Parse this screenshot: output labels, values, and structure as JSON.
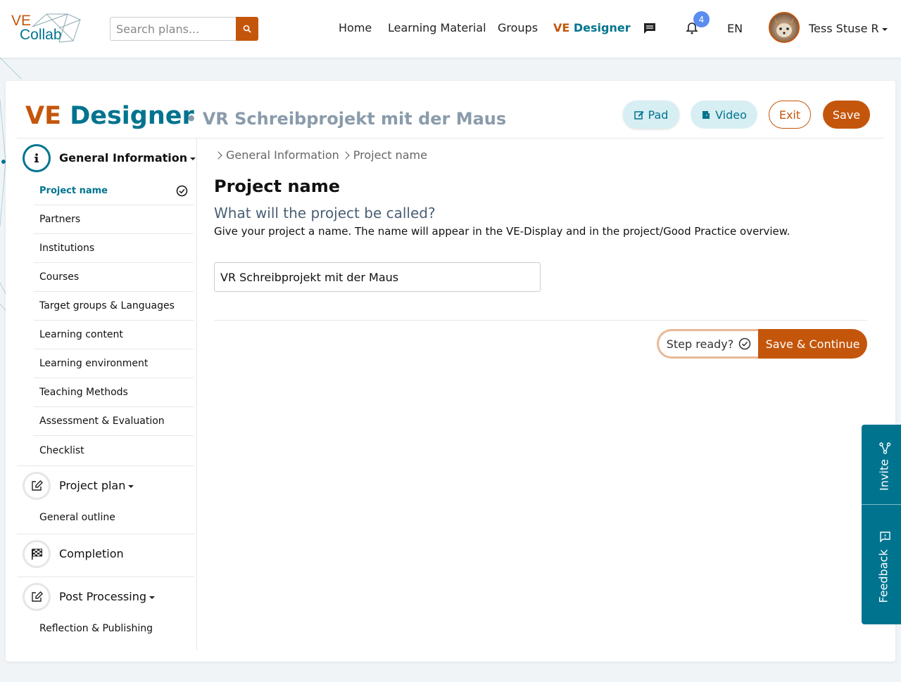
{
  "header": {
    "logo_top": "VE",
    "logo_bottom": "Collab",
    "search_placeholder": "Search plans...",
    "nav": [
      "Home",
      "Learning Material",
      "Groups"
    ],
    "nav_active_a": "VE",
    "nav_active_b": "Designer",
    "notification_count": "4",
    "language": "EN",
    "username": "Tess Stuse R"
  },
  "page": {
    "title_a": "VE",
    "title_b": "Designer",
    "plan_name": "• VR Schreibprojekt mit der Maus",
    "buttons": {
      "pad": "Pad",
      "video": "Video",
      "exit": "Exit",
      "save": "Save"
    }
  },
  "sidebar": {
    "sections": [
      {
        "label": "General Information",
        "icon": "info-icon"
      },
      {
        "label": "Project plan",
        "icon": "edit-icon"
      },
      {
        "label": "Completion",
        "icon": "checkered-flag-icon"
      },
      {
        "label": "Post Processing",
        "icon": "edit-icon"
      }
    ],
    "general_items": [
      "Project name",
      "Partners",
      "Institutions",
      "Courses",
      "Target groups & Languages",
      "Learning content",
      "Learning environment",
      "Teaching Methods",
      "Assessment & Evaluation",
      "Checklist"
    ],
    "plan_items": [
      "General outline"
    ],
    "post_items": [
      "Reflection & Publishing"
    ]
  },
  "content": {
    "breadcrumb": [
      "General Information",
      "Project name"
    ],
    "heading": "Project name",
    "question": "What will the project be called?",
    "description": "Give your project a name. The name will appear in the VE-Display and in the project/Good Practice overview.",
    "name_value": "VR Schreibprojekt mit der Maus",
    "step_ready": "Step ready?",
    "save_continue": "Save & Continue"
  },
  "side_tab": {
    "invite": "Invite",
    "feedback": "Feedback"
  },
  "colors": {
    "orange": "#c4560c",
    "teal": "#00748f",
    "muted": "#8a9bab"
  }
}
